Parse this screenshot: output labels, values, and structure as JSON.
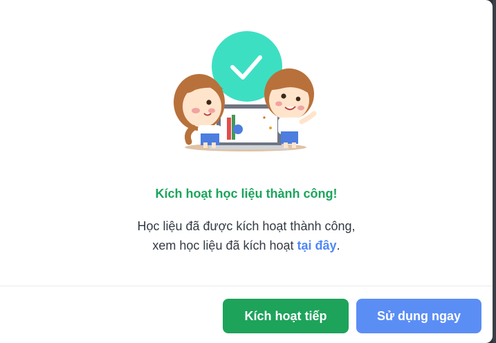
{
  "dialog": {
    "title": "Kích hoạt học liệu thành công!",
    "message_line1": "Học liệu đã được kích hoạt thành công,",
    "message_line2_prefix": "xem học liệu đã kích hoạt ",
    "message_link": "tại đây",
    "message_line2_suffix": "."
  },
  "actions": {
    "continue_label": "Kích hoạt tiếp",
    "use_now_label": "Sử dụng ngay"
  },
  "colors": {
    "title": "#1aa55b",
    "link": "#4f86f7",
    "continue_button": "#1ea35b",
    "use_now_button": "#5b8ef5",
    "check_circle": "#3ddfc3"
  },
  "icons": {
    "success": "check-circle-icon"
  }
}
